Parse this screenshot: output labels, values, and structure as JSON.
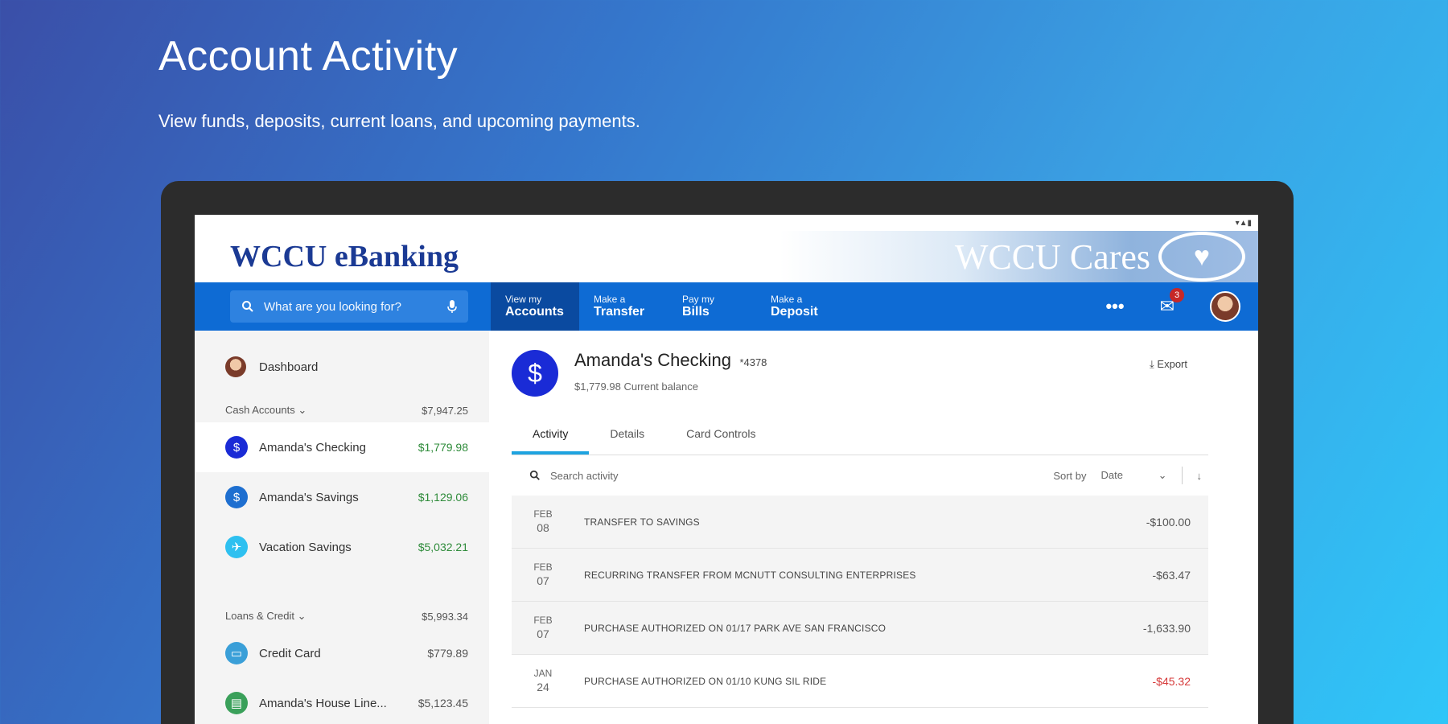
{
  "hero": {
    "title": "Account Activity",
    "subtitle": "View funds, deposits, current loans, and upcoming payments."
  },
  "app": {
    "brand": "WCCU eBanking",
    "cares": "WCCU Cares"
  },
  "nav": {
    "search_placeholder": "What are you looking for?",
    "items": [
      {
        "small": "View my",
        "big": "Accounts"
      },
      {
        "small": "Make a",
        "big": "Transfer"
      },
      {
        "small": "Pay my",
        "big": "Bills"
      },
      {
        "small": "Make a",
        "big": "Deposit"
      }
    ],
    "more": "•••",
    "mail_badge": "3"
  },
  "sidebar": {
    "dashboard": "Dashboard",
    "cash_header": "Cash Accounts",
    "cash_total": "$7,947.25",
    "cash_accounts": [
      {
        "name": "Amanda's Checking",
        "amount": "$1,779.98",
        "color": "#1a2bd6",
        "icon": "$"
      },
      {
        "name": "Amanda's Savings",
        "amount": "$1,129.06",
        "color": "#1e6fd0",
        "icon": "$"
      },
      {
        "name": "Vacation Savings",
        "amount": "$5,032.21",
        "color": "#2ec0f0",
        "icon": "✈"
      }
    ],
    "loans_header": "Loans & Credit",
    "loans_total": "$5,993.34",
    "loans": [
      {
        "name": "Credit Card",
        "amount": "$779.89",
        "color": "#3a9fd8",
        "icon": "▭"
      },
      {
        "name": "Amanda's House Line...",
        "amount": "$5,123.45",
        "color": "#3aa05a",
        "icon": "▤"
      }
    ]
  },
  "account": {
    "title": "Amanda's Checking",
    "mask": "*4378",
    "balance": "$1,779.98 Current balance",
    "export": "Export",
    "tabs": [
      "Activity",
      "Details",
      "Card Controls"
    ],
    "search_placeholder": "Search activity",
    "sort_label": "Sort by",
    "sort_value": "Date"
  },
  "transactions": [
    {
      "month": "FEB",
      "day": "08",
      "desc": "TRANSFER TO SAVINGS",
      "amount": "-$100.00",
      "negative": false
    },
    {
      "month": "FEB",
      "day": "07",
      "desc": "RECURRING TRANSFER FROM MCNUTT CONSULTING ENTERPRISES",
      "amount": "-$63.47",
      "negative": false
    },
    {
      "month": "FEB",
      "day": "07",
      "desc": "PURCHASE AUTHORIZED ON 01/17 PARK AVE SAN FRANCISCO",
      "amount": "-1,633.90",
      "negative": false
    },
    {
      "month": "JAN",
      "day": "24",
      "desc": "PURCHASE AUTHORIZED ON 01/10 KUNG SIL RIDE",
      "amount": "-$45.32",
      "negative": true
    }
  ]
}
